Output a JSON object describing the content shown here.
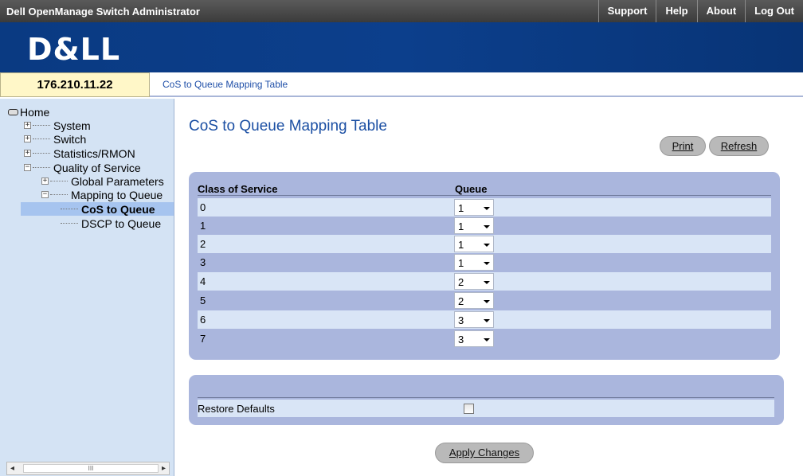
{
  "header": {
    "app_title": "Dell OpenManage Switch Administrator",
    "links": [
      "Support",
      "Help",
      "About",
      "Log Out"
    ],
    "logo_text": "D&LL"
  },
  "ip_address": "176.210.11.22",
  "breadcrumb": "CoS to Queue Mapping Table",
  "nav": {
    "home": "Home",
    "system": "System",
    "switch": "Switch",
    "statistics": "Statistics/RMON",
    "qos": "Quality of Service",
    "global_params": "Global Parameters",
    "mapping": "Mapping to Queue",
    "cos_to_queue": "CoS to Queue",
    "dscp_to_queue": "DSCP to Queue"
  },
  "scrollbar": {
    "thumb_glyph": "III"
  },
  "page": {
    "title": "CoS to Queue Mapping Table",
    "print_label": "Print",
    "refresh_label": "Refresh"
  },
  "table": {
    "col_cos": "Class of Service",
    "col_queue": "Queue",
    "rows": [
      {
        "cos": "0",
        "queue": "1"
      },
      {
        "cos": "1",
        "queue": "1"
      },
      {
        "cos": "2",
        "queue": "1"
      },
      {
        "cos": "3",
        "queue": "1"
      },
      {
        "cos": "4",
        "queue": "2"
      },
      {
        "cos": "5",
        "queue": "2"
      },
      {
        "cos": "6",
        "queue": "3"
      },
      {
        "cos": "7",
        "queue": "3"
      }
    ]
  },
  "restore": {
    "label": "Restore Defaults",
    "checked": false
  },
  "apply_label": "Apply Changes"
}
